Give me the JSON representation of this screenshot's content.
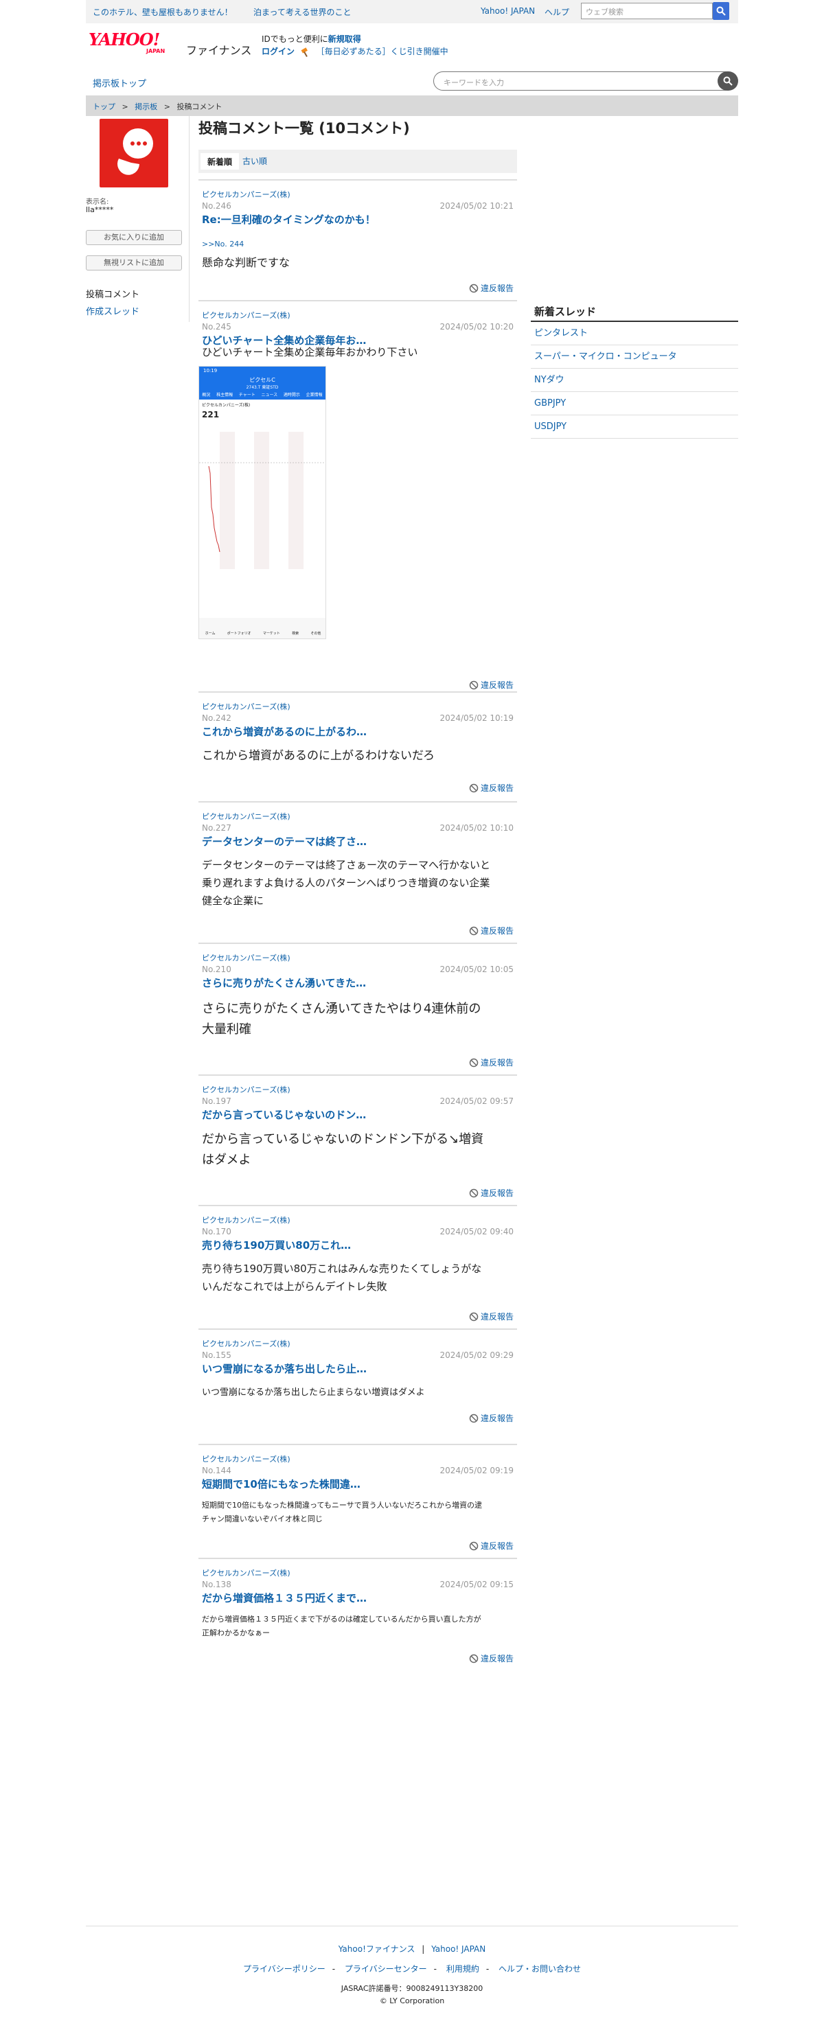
{
  "topbar": {
    "ad1": "このホテル、壁も屋根もありません！",
    "ad2": "泊まって考える世界のこと",
    "yahoo_japan": "Yahoo! JAPAN",
    "help": "ヘルプ",
    "web_search_placeholder": "ウェブ検索"
  },
  "header": {
    "logo_text": "YAHOO!",
    "logo_sub": "JAPAN",
    "service": "ファイナンス",
    "msg_prefix": "IDでもっと便利に",
    "msg_signup": "新規取得",
    "login": "ログイン",
    "campaign": "［毎日必ずあたる］くじ引き開催中"
  },
  "subnav": {
    "board_top": "掲示板トップ",
    "keyword_placeholder": "キーワードを入力"
  },
  "breadcrumb": [
    "トップ",
    "掲示板",
    "投稿コメント"
  ],
  "breadcrumb_sep": ">",
  "sidebar": {
    "display_name_label": "表示名:",
    "display_name": "lla*****",
    "fav_button": "お気に入りに追加",
    "ignore_button": "無視リストに追加",
    "posts_link": "投稿コメント",
    "threads_link": "作成スレッド"
  },
  "main": {
    "title": "投稿コメント一覧 (10コメント)",
    "tab_newest": "新着順",
    "tab_oldest": "古い順",
    "report_label": "違反報告",
    "comments": [
      {
        "company": "ピクセルカンパニーズ(株)",
        "no": "No.246",
        "date": "2024/05/02 10:21",
        "title": "Re:一旦利確のタイミングなのかも！",
        "reply": ">>No. 244",
        "body": "懸命な判断ですな"
      },
      {
        "company": "ピクセルカンパニーズ(株)",
        "no": "No.245",
        "date": "2024/05/02 10:20",
        "title": "ひどいチャート全集め企業毎年お…",
        "reply": "",
        "body": "ひどいチャート全集め企業毎年おかわり下さい"
      },
      {
        "company": "ピクセルカンパニーズ(株)",
        "no": "No.242",
        "date": "2024/05/02 10:19",
        "title": "これから増資があるのに上がるわ…",
        "reply": "",
        "body": "これから増資があるのに上がるわけないだろ"
      },
      {
        "company": "ピクセルカンパニーズ(株)",
        "no": "No.227",
        "date": "2024/05/02 10:10",
        "title": "データセンターのテーマは終了さ…",
        "reply": "",
        "body": "データセンターのテーマは終了さぁー次のテーマへ行かないと\n乗り遅れますよ負ける人のパターンへばりつき増資のない企業\n健全な企業に"
      },
      {
        "company": "ピクセルカンパニーズ(株)",
        "no": "No.210",
        "date": "2024/05/02 10:05",
        "title": "さらに売りがたくさん湧いてきた…",
        "reply": "",
        "body": "さらに売りがたくさん湧いてきたやはり4連休前の\n大量利確"
      },
      {
        "company": "ピクセルカンパニーズ(株)",
        "no": "No.197",
        "date": "2024/05/02 09:57",
        "title": "だから言っているじゃないのドン…",
        "reply": "",
        "body": "だから言っているじゃないのドンドン下がる↘増資\nはダメよ"
      },
      {
        "company": "ピクセルカンパニーズ(株)",
        "no": "No.170",
        "date": "2024/05/02 09:40",
        "title": "売り待ち190万買い80万これ…",
        "reply": "",
        "body": "売り待ち190万買い80万これはみんな売りたくてしょうがな\nいんだなこれでは上がらんデイトレ失敗"
      },
      {
        "company": "ピクセルカンパニーズ(株)",
        "no": "No.155",
        "date": "2024/05/02 09:29",
        "title": "いつ雪崩になるか落ち出したら止…",
        "reply": "",
        "body": "いつ雪崩になるか落ち出したら止まらない増資はダメよ"
      },
      {
        "company": "ピクセルカンパニーズ(株)",
        "no": "No.144",
        "date": "2024/05/02 09:19",
        "title": "短期間で10倍にもなった株間違…",
        "reply": "",
        "body": "短期間で10倍にもなった株間違ってもニーサで買う人いないだろこれから増資の逮\nチャン間違いないぞバイオ株と同じ"
      },
      {
        "company": "ピクセルカンパニーズ(株)",
        "no": "No.138",
        "date": "2024/05/02 09:15",
        "title": "だから増資価格１３５円近くまで…",
        "reply": "",
        "body": "だから増資価格１３５円近くまで下がるのは確定しているんだから買い直した方が\n正解わかるかなぁー"
      }
    ],
    "screenshot": {
      "time": "10:19",
      "name": "ピクセルC",
      "code": "2743.T 東証STD",
      "tabs": [
        "概況",
        "株主情報",
        "チャート",
        "ニュース",
        "適時開示",
        "企業情報"
      ],
      "company": "ピクセルカンパニーズ(株)",
      "price": "221",
      "bottom_tabs": [
        "ホーム",
        "ポートフォリオ",
        "マーケット",
        "検索",
        "その他"
      ]
    }
  },
  "right": {
    "heading": "新着スレッド",
    "threads": [
      "ピンタレスト",
      "スーパー・マイクロ・コンピュータ",
      "NYダウ",
      "GBPJPY",
      "USDJPY"
    ]
  },
  "footer": {
    "link1": "Yahoo!ファイナンス",
    "link2": "Yahoo! JAPAN",
    "links": [
      "プライバシーポリシー",
      "プライバシーセンター",
      "利用規約",
      "ヘルプ・お問い合わせ"
    ],
    "jasrac": "JASRAC許諾番号：9008249113Y38200",
    "copyright": "© LY Corporation"
  },
  "colors": {
    "link": "#0f61a8",
    "brand": "#ff0033",
    "avatar": "#e2221c"
  }
}
